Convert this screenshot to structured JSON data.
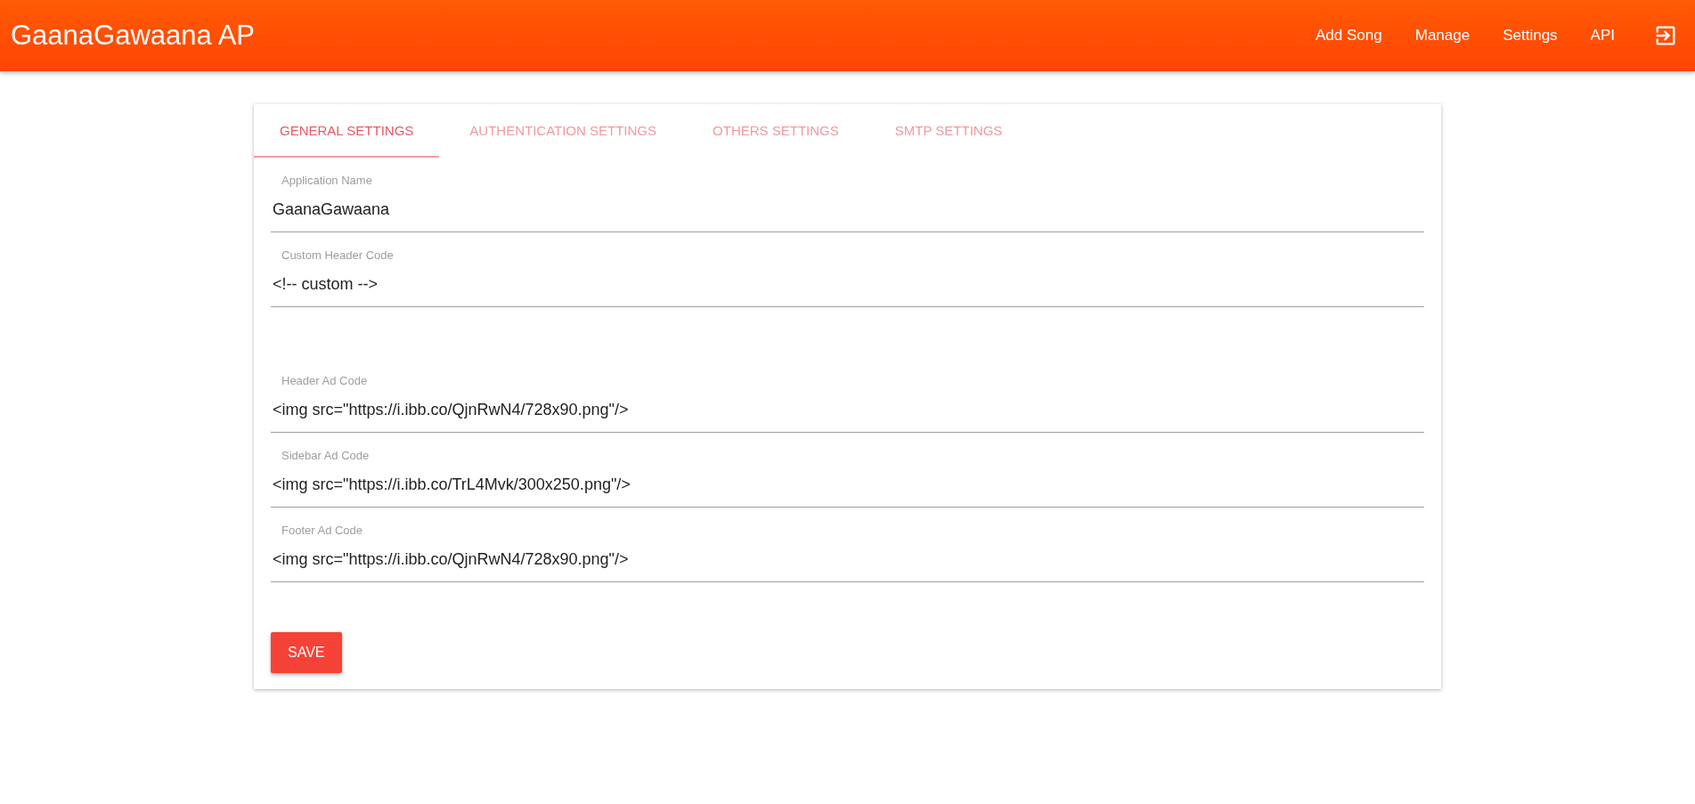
{
  "app_bar": {
    "title": "GaanaGawaana AP",
    "nav": [
      {
        "label": "Add Song"
      },
      {
        "label": "Manage"
      },
      {
        "label": "Settings"
      },
      {
        "label": "API"
      }
    ]
  },
  "tabs": [
    {
      "label": "GENERAL SETTINGS",
      "selected": true
    },
    {
      "label": "AUTHENTICATION SETTINGS",
      "selected": false
    },
    {
      "label": "OTHERS SETTINGS",
      "selected": false
    },
    {
      "label": "SMTP SETTINGS",
      "selected": false
    }
  ],
  "field_groups": [
    [
      {
        "label": "Application Name",
        "value": "GaanaGawaana"
      },
      {
        "label": "Custom Header Code",
        "value": "<!-- custom -->"
      }
    ],
    [
      {
        "label": "Header Ad Code",
        "value": "<img src=\"https://i.ibb.co/QjnRwN4/728x90.png\"/>"
      },
      {
        "label": "Sidebar Ad Code",
        "value": "<img src=\"https://i.ibb.co/TrL4Mvk/300x250.png\"/>"
      },
      {
        "label": "Footer Ad Code",
        "value": "<img src=\"https://i.ibb.co/QjnRwN4/728x90.png\"/>"
      }
    ]
  ],
  "save_button": "SAVE"
}
